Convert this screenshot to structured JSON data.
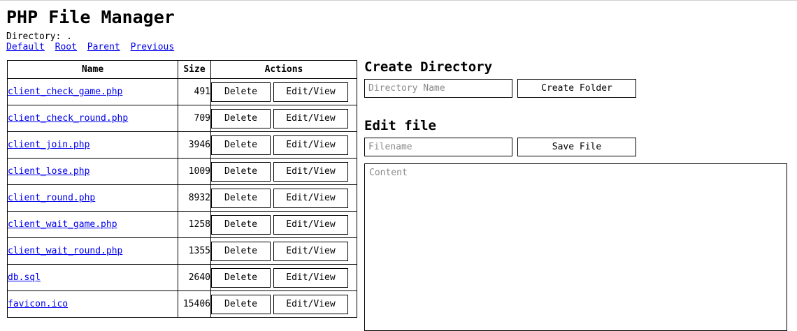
{
  "title": "PHP File Manager",
  "directory": {
    "label": "Directory:",
    "value": "."
  },
  "nav_links": [
    "Default",
    "Root",
    "Parent",
    "Previous"
  ],
  "table": {
    "headers": {
      "name": "Name",
      "size": "Size",
      "actions": "Actions"
    },
    "delete_label": "Delete",
    "edit_label": "Edit/View",
    "rows": [
      {
        "name": "client_check_game.php",
        "size": "491"
      },
      {
        "name": "client_check_round.php",
        "size": "709"
      },
      {
        "name": "client_join.php",
        "size": "3946"
      },
      {
        "name": "client_lose.php",
        "size": "1009"
      },
      {
        "name": "client_round.php",
        "size": "8932"
      },
      {
        "name": "client_wait_game.php",
        "size": "1258"
      },
      {
        "name": "client_wait_round.php",
        "size": "1355"
      },
      {
        "name": "db.sql",
        "size": "2640"
      },
      {
        "name": "favicon.ico",
        "size": "15406"
      }
    ]
  },
  "create_directory": {
    "heading": "Create Directory",
    "placeholder": "Directory Name",
    "button_label": "Create Folder"
  },
  "edit_file": {
    "heading": "Edit file",
    "filename_placeholder": "Filename",
    "button_label": "Save File",
    "content_placeholder": "Content"
  }
}
